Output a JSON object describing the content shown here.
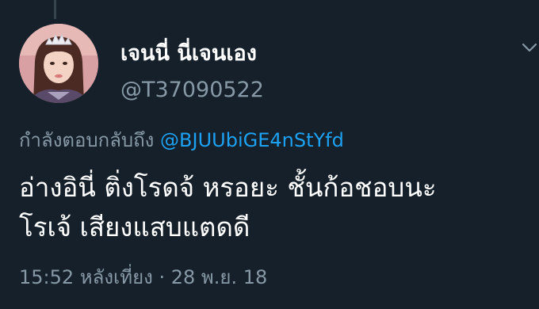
{
  "tweet": {
    "author": {
      "display_name": "เจนนี่ นี่เจนเอง",
      "handle": "@T37090522",
      "avatar_icon": "profile-photo"
    },
    "reply": {
      "prefix": "กำลังตอบกลับถึง",
      "mention": "@BJUUbiGE4nStYfd"
    },
    "text_lines": [
      "อ่างอินี่ ติ่งโรดจ้ หรอยะ ชั้นก้อชอบนะ",
      "โรเจ้ เสียงแสบแตดดี"
    ],
    "time": "15:52 หลังเที่ยง",
    "separator": "·",
    "date": "28 พ.ย. 18",
    "menu_icon": "chevron-down-icon"
  },
  "colors": {
    "background": "#15202b",
    "primary_text": "#ffffff",
    "secondary_text": "#8899a6",
    "link": "#1da1f2",
    "thread_line": "#38444d"
  }
}
